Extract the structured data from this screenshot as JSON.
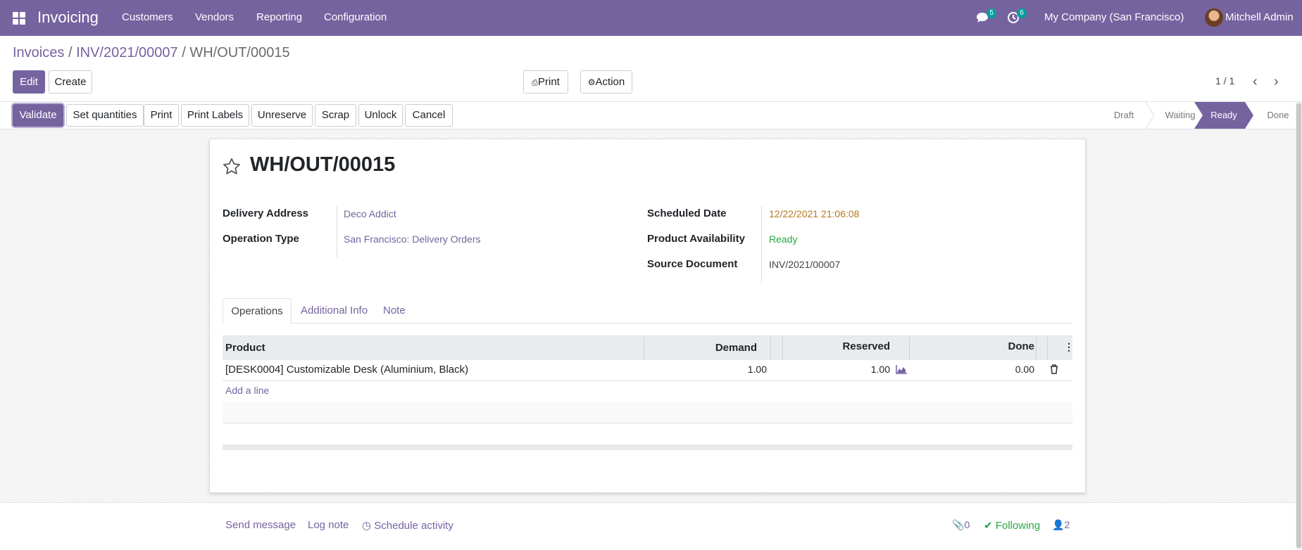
{
  "navbar": {
    "app_title": "Invoicing",
    "menu": [
      "Customers",
      "Vendors",
      "Reporting",
      "Configuration"
    ],
    "messages_count": "5",
    "activities_count": "6",
    "company": "My Company (San Francisco)",
    "user": "Mitchell Admin",
    "color": "#7563a0"
  },
  "breadcrumb": {
    "item1": "Invoices",
    "item2": "INV/2021/00007",
    "current": "WH/OUT/00015",
    "sep": "/"
  },
  "controls": {
    "edit": "Edit",
    "create": "Create",
    "print": "Print",
    "action": "Action",
    "pager": "1 / 1"
  },
  "header_buttons": {
    "validate": "Validate",
    "set_quantities": "Set quantities",
    "print": "Print",
    "print_labels": "Print Labels",
    "unreserve": "Unreserve",
    "scrap": "Scrap",
    "unlock": "Unlock",
    "cancel": "Cancel"
  },
  "stages": {
    "draft": "Draft",
    "waiting": "Waiting",
    "ready": "Ready",
    "done": "Done",
    "active": "Ready"
  },
  "record": {
    "name": "WH/OUT/00015",
    "delivery_address_label": "Delivery Address",
    "delivery_address": "Deco Addict",
    "operation_type_label": "Operation Type",
    "operation_type": "San Francisco: Delivery Orders",
    "scheduled_date_label": "Scheduled Date",
    "scheduled_date": "12/22/2021 21:06:08",
    "availability_label": "Product Availability",
    "availability": "Ready",
    "source_label": "Source Document",
    "source": "INV/2021/00007"
  },
  "tabs": {
    "operations": "Operations",
    "additional_info": "Additional Info",
    "note": "Note"
  },
  "table": {
    "headers": {
      "product": "Product",
      "demand": "Demand",
      "reserved": "Reserved",
      "done": "Done"
    },
    "row": {
      "product": "[DESK0004] Customizable Desk (Aluminium, Black)",
      "demand": "1.00",
      "reserved": "1.00",
      "done": "0.00"
    },
    "add_line": "Add a line"
  },
  "chatter": {
    "send_message": "Send message",
    "log_note": "Log note",
    "schedule_activity": "Schedule activity",
    "attachments": "0",
    "following": "Following",
    "followers": "2"
  }
}
